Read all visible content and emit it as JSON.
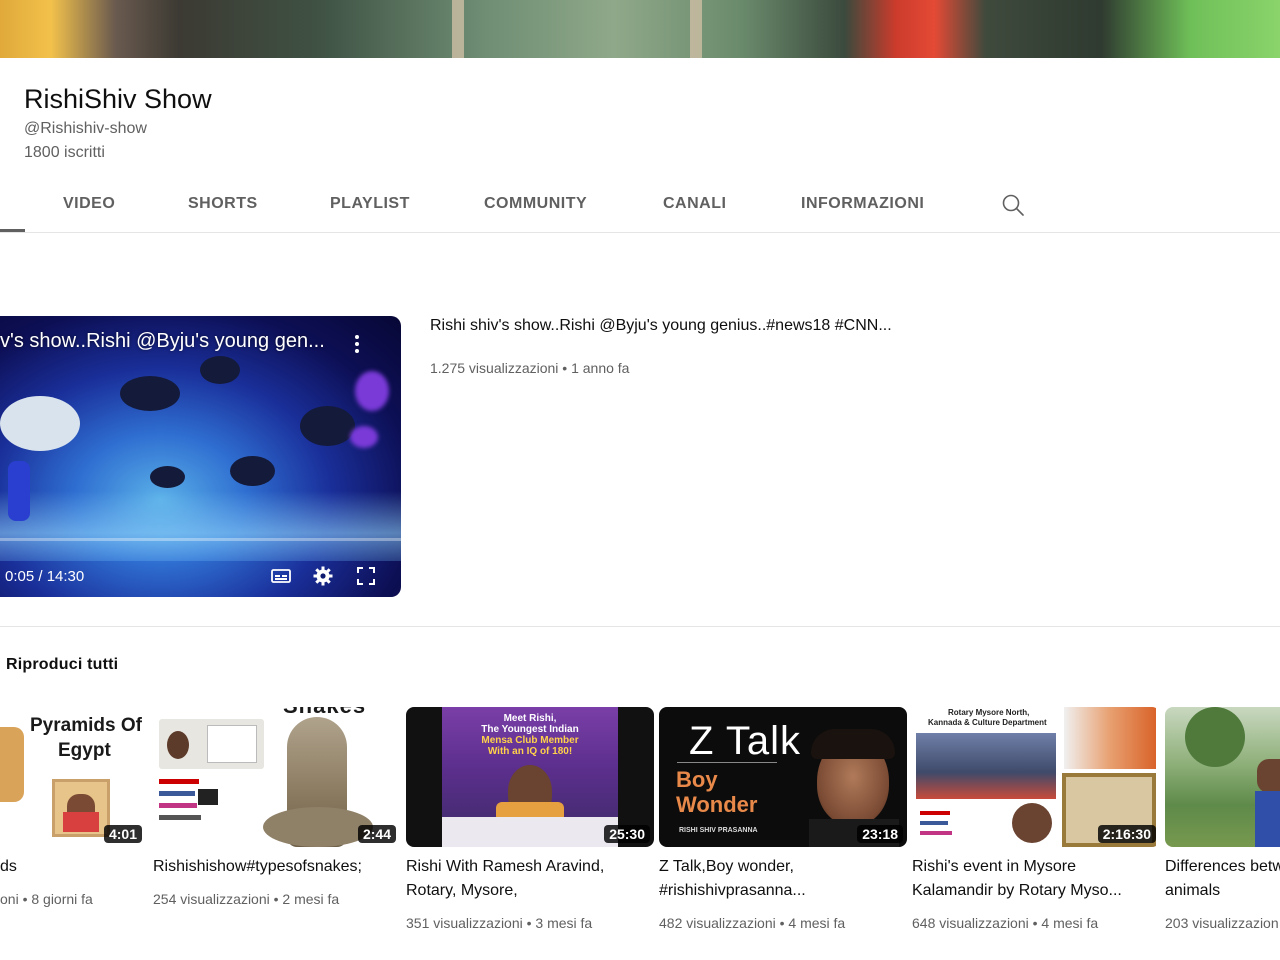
{
  "channel": {
    "name": "RishiShiv Show",
    "handle": "@Rishishiv-show",
    "subscribers": "1800 iscritti"
  },
  "tabs": [
    {
      "label": "VIDEO"
    },
    {
      "label": "SHORTS"
    },
    {
      "label": "PLAYLIST"
    },
    {
      "label": "COMMUNITY"
    },
    {
      "label": "CANALI"
    },
    {
      "label": "INFORMAZIONI"
    }
  ],
  "featured": {
    "player_title": "v's show..Rishi @Byju's young gen...",
    "time": "0:05 / 14:30",
    "title": "Rishi shiv's show..Rishi @Byju's young genius..#news18 #CNN...",
    "meta": "1.275 visualizzazioni • 1 anno fa"
  },
  "section": {
    "play_all": "Riproduci tutti"
  },
  "videos": [
    {
      "title1": "ds",
      "title2": "",
      "meta": "oni • 8 giorni fa",
      "duration": "4:01",
      "thumb_text1": "Pyramids Of",
      "thumb_text2": "Egypt"
    },
    {
      "title1": "Rishishishow#typesofsnakes;",
      "title2": "",
      "meta": "254 visualizzazioni • 2 mesi fa",
      "duration": "2:44",
      "thumb_text1": "Snakes"
    },
    {
      "title1": "Rishi With Ramesh Aravind,",
      "title2": "Rotary, Mysore,",
      "meta": "351 visualizzazioni • 3 mesi fa",
      "duration": "25:30",
      "thumb_text1": "Meet Rishi,",
      "thumb_text2": "The Youngest Indian",
      "thumb_text3": "Mensa Club Member",
      "thumb_text4": "With an IQ of 180!"
    },
    {
      "title1": "Z Talk,Boy wonder,",
      "title2": "#rishishivprasanna...",
      "meta": "482 visualizzazioni • 4 mesi fa",
      "duration": "23:18",
      "thumb_text1": "Z Talk",
      "thumb_text2": "Boy",
      "thumb_text3": "Wonder",
      "thumb_text4": "RISHI SHIV PRASANNA"
    },
    {
      "title1": "Rishi's event in Mysore",
      "title2": "Kalamandir by Rotary Myso...",
      "meta": "648 visualizzazioni • 4 mesi fa",
      "duration": "2:16:30",
      "thumb_text1": "Rotary Mysore North,",
      "thumb_text2": "Kannada & Culture Department"
    },
    {
      "title1": "Differences betw",
      "title2": "animals",
      "meta": "203 visualizzazion",
      "duration": ""
    }
  ],
  "colors": {
    "text_primary": "#0f0f0f",
    "text_secondary": "#606060",
    "divider": "#e5e5e5"
  }
}
